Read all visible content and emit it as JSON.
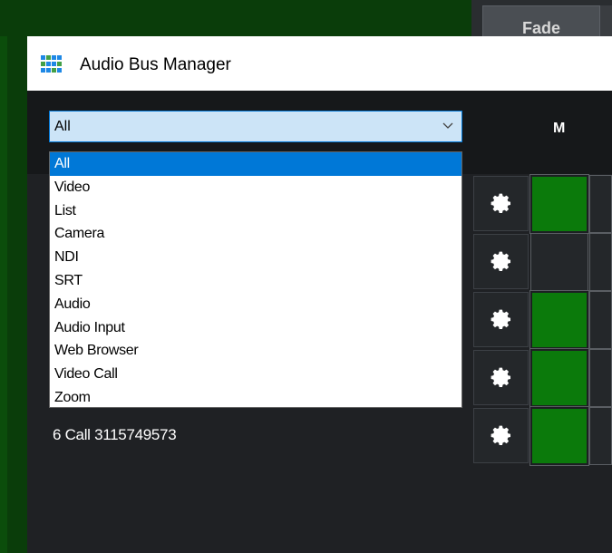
{
  "background": {
    "fade_label": "Fade"
  },
  "window": {
    "title": "Audio Bus Manager"
  },
  "filter": {
    "selected": "All",
    "options": [
      "All",
      "Video",
      "List",
      "Camera",
      "NDI",
      "SRT",
      "Audio",
      "Audio Input",
      "Web Browser",
      "Video Call",
      "Zoom"
    ]
  },
  "columns": {
    "m_label": "M"
  },
  "rows": [
    {
      "label": "",
      "mute_on": true
    },
    {
      "label": "",
      "mute_on": false
    },
    {
      "label": "",
      "mute_on": true
    },
    {
      "label": "",
      "mute_on": true
    },
    {
      "label": "6 Call 3115749573",
      "mute_on": true
    }
  ],
  "colors": {
    "active_green": "#0b7a0b",
    "selection_blue": "#0078d7",
    "combo_bg": "#cce4f7"
  }
}
